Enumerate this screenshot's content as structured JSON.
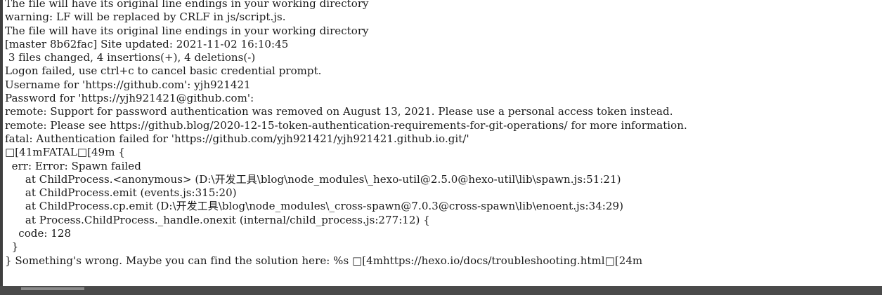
{
  "console": {
    "lines": [
      "The file will have its original line endings in your working directory",
      "warning: LF will be replaced by CRLF in js/script.js.",
      "The file will have its original line endings in your working directory",
      "[master 8b62fac] Site updated: 2021-11-02 16:10:45",
      " 3 files changed, 4 insertions(+), 4 deletions(-)",
      "Logon failed, use ctrl+c to cancel basic credential prompt.",
      "Username for 'https://github.com': yjh921421",
      "Password for 'https://yjh921421@github.com':",
      "remote: Support for password authentication was removed on August 13, 2021. Please use a personal access token instead.",
      "remote: Please see https://github.blog/2020-12-15-token-authentication-requirements-for-git-operations/ for more information.",
      "fatal: Authentication failed for 'https://github.com/yjh921421/yjh921421.github.io.git/'",
      "□[41mFATAL□[49m {",
      "  err: Error: Spawn failed",
      "      at ChildProcess.<anonymous> (D:\\开发工具\\blog\\node_modules\\_hexo-util@2.5.0@hexo-util\\lib\\spawn.js:51:21)",
      "      at ChildProcess.emit (events.js:315:20)",
      "      at ChildProcess.cp.emit (D:\\开发工具\\blog\\node_modules\\_cross-spawn@7.0.3@cross-spawn\\lib\\enoent.js:34:29)",
      "      at Process.ChildProcess._handle.onexit (internal/child_process.js:277:12) {",
      "    code: 128",
      "  }",
      "} Something's wrong. Maybe you can find the solution here: %s □[4mhttps://hexo.io/docs/troubleshooting.html□[24m"
    ]
  }
}
